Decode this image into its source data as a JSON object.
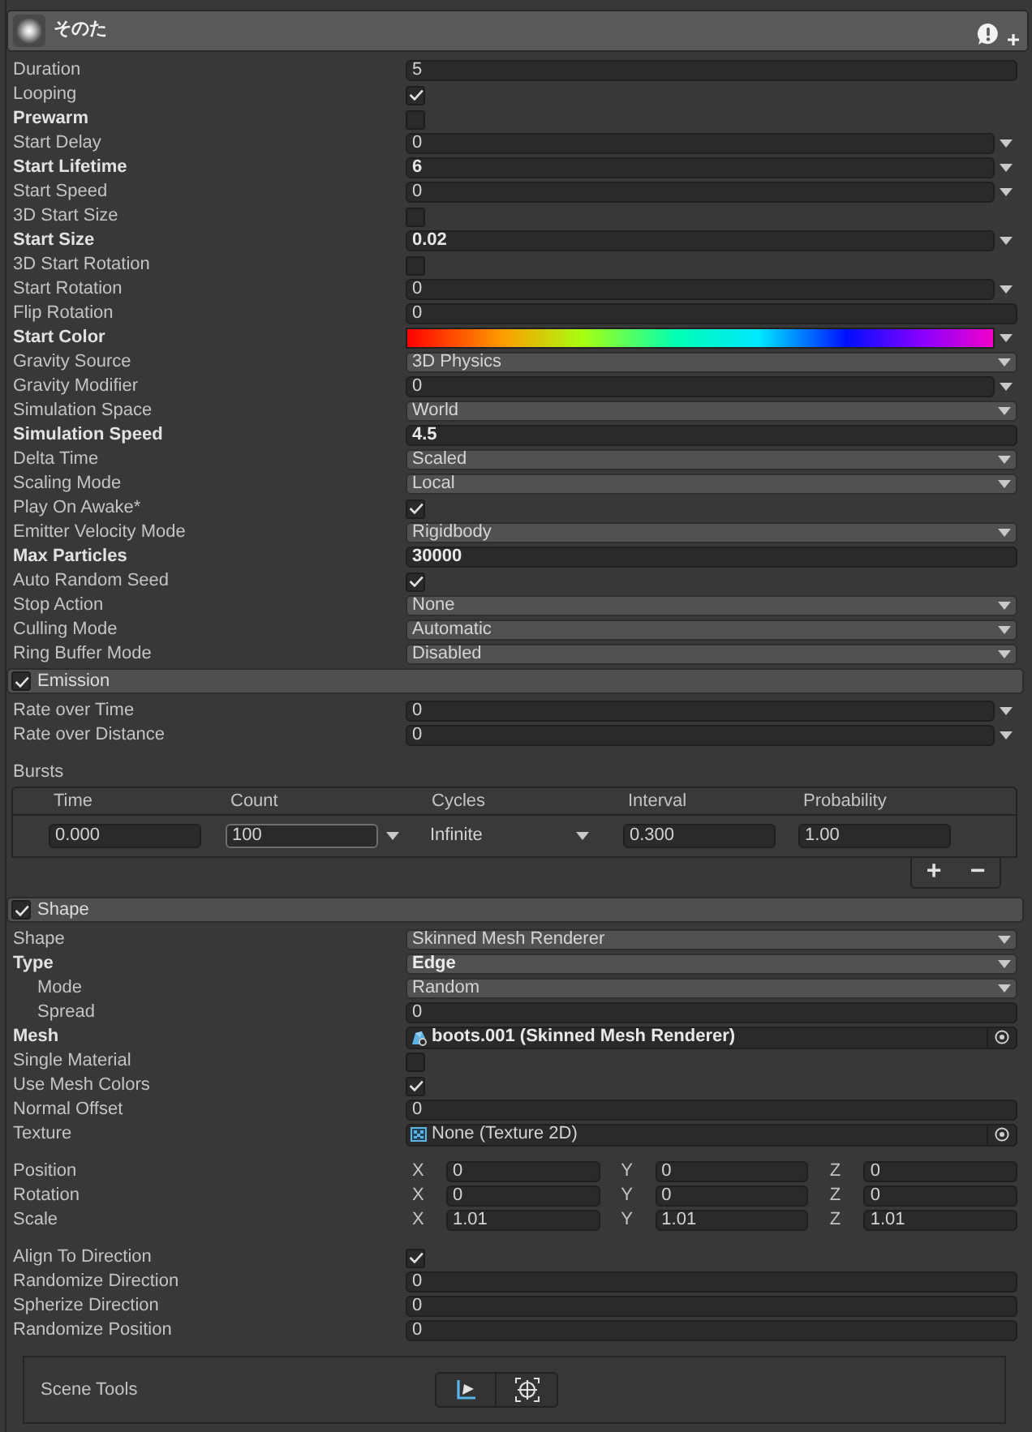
{
  "component": {
    "title": "そのた"
  },
  "main": {
    "properties": [
      {
        "label": "Duration",
        "kind": "field",
        "value": "5",
        "bold": false
      },
      {
        "label": "Looping",
        "kind": "checkbox",
        "checked": true,
        "bold": false
      },
      {
        "label": "Prewarm",
        "kind": "checkbox",
        "checked": false,
        "bold": true
      },
      {
        "label": "Start Delay",
        "kind": "curve",
        "value": "0",
        "bold": false
      },
      {
        "label": "Start Lifetime",
        "kind": "curve",
        "value": "6",
        "bold": true
      },
      {
        "label": "Start Speed",
        "kind": "curve",
        "value": "0",
        "bold": false
      },
      {
        "label": "3D Start Size",
        "kind": "checkbox",
        "checked": false,
        "bold": false
      },
      {
        "label": "Start Size",
        "kind": "curve",
        "value": "0.02",
        "bold": true
      },
      {
        "label": "3D Start Rotation",
        "kind": "checkbox",
        "checked": false,
        "bold": false
      },
      {
        "label": "Start Rotation",
        "kind": "curve",
        "value": "0",
        "bold": false
      },
      {
        "label": "Flip Rotation",
        "kind": "field",
        "value": "0",
        "bold": false
      },
      {
        "label": "Start Color",
        "kind": "gradient",
        "bold": true
      },
      {
        "label": "Gravity Source",
        "kind": "dropdown",
        "value": "3D Physics",
        "bold": false
      },
      {
        "label": "Gravity Modifier",
        "kind": "curve",
        "value": "0",
        "bold": false
      },
      {
        "label": "Simulation Space",
        "kind": "dropdown",
        "value": "World",
        "bold": false
      },
      {
        "label": "Simulation Speed",
        "kind": "field",
        "value": "4.5",
        "bold": true
      },
      {
        "label": "Delta Time",
        "kind": "dropdown",
        "value": "Scaled",
        "bold": false
      },
      {
        "label": "Scaling Mode",
        "kind": "dropdown",
        "value": "Local",
        "bold": false
      },
      {
        "label": "Play On Awake*",
        "kind": "checkbox",
        "checked": true,
        "bold": false
      },
      {
        "label": "Emitter Velocity Mode",
        "kind": "dropdown",
        "value": "Rigidbody",
        "bold": false
      },
      {
        "label": "Max Particles",
        "kind": "field",
        "value": "30000",
        "bold": true
      },
      {
        "label": "Auto Random Seed",
        "kind": "checkbox",
        "checked": true,
        "bold": false
      },
      {
        "label": "Stop Action",
        "kind": "dropdown",
        "value": "None",
        "bold": false
      },
      {
        "label": "Culling Mode",
        "kind": "dropdown",
        "value": "Automatic",
        "bold": false
      },
      {
        "label": "Ring Buffer Mode",
        "kind": "dropdown",
        "value": "Disabled",
        "bold": false
      }
    ]
  },
  "modules": [
    {
      "title": "Emission",
      "enabled": true,
      "property_groups": [
        {
          "properties": [
            {
              "label": "Rate over Time",
              "kind": "curve",
              "value": "0",
              "bold": false
            },
            {
              "label": "Rate over Distance",
              "kind": "curve",
              "value": "0",
              "bold": false
            }
          ]
        }
      ],
      "bursts": {
        "label": "Bursts",
        "columns": [
          "Time",
          "Count",
          "Cycles",
          "Interval",
          "Probability"
        ],
        "rows": [
          {
            "cells": [
              {
                "kind": "field",
                "value": "0.000",
                "highlighted": false
              },
              {
                "kind": "curve",
                "value": "100",
                "highlighted": true
              },
              {
                "kind": "choice",
                "value": "Infinite",
                "highlighted": false
              },
              {
                "kind": "field",
                "value": "0.300",
                "highlighted": false
              },
              {
                "kind": "field",
                "value": "1.00",
                "highlighted": false
              }
            ]
          }
        ],
        "buttons": [
          "+",
          "−"
        ]
      }
    },
    {
      "title": "Shape",
      "enabled": true,
      "property_groups": [
        {
          "properties": [
            {
              "label": "Shape",
              "kind": "dropdown",
              "value": "Skinned Mesh Renderer",
              "bold": false
            },
            {
              "label": "Type",
              "kind": "dropdown",
              "value": "Edge",
              "bold": true,
              "children": [
                {
                  "label": "Mode",
                  "kind": "dropdown",
                  "value": "Random",
                  "bold": false
                },
                {
                  "label": "Spread",
                  "kind": "field",
                  "value": "0",
                  "bold": false
                }
              ]
            },
            {
              "label": "Mesh",
              "kind": "mesh",
              "value": "boots.001 (Skinned Mesh Renderer)",
              "bold": true
            },
            {
              "label": "Single Material",
              "kind": "checkbox",
              "checked": false,
              "bold": false
            },
            {
              "label": "Use Mesh Colors",
              "kind": "checkbox",
              "checked": true,
              "bold": false
            },
            {
              "label": "Normal Offset",
              "kind": "field",
              "value": "0",
              "bold": false
            },
            {
              "label": "Texture",
              "kind": "texture",
              "value": "None (Texture 2D)",
              "bold": false
            }
          ]
        },
        {
          "properties": [
            {
              "label": "Position",
              "kind": "vector3",
              "bold": false,
              "components": [
                {
                  "axis": "X",
                  "value": "0"
                },
                {
                  "axis": "Y",
                  "value": "0"
                },
                {
                  "axis": "Z",
                  "value": "0"
                }
              ]
            },
            {
              "label": "Rotation",
              "kind": "vector3",
              "bold": false,
              "components": [
                {
                  "axis": "X",
                  "value": "0"
                },
                {
                  "axis": "Y",
                  "value": "0"
                },
                {
                  "axis": "Z",
                  "value": "0"
                }
              ]
            },
            {
              "label": "Scale",
              "kind": "vector3",
              "bold": false,
              "components": [
                {
                  "axis": "X",
                  "value": "1.01"
                },
                {
                  "axis": "Y",
                  "value": "1.01"
                },
                {
                  "axis": "Z",
                  "value": "1.01"
                }
              ]
            }
          ]
        },
        {
          "properties": [
            {
              "label": "Align To Direction",
              "kind": "checkbox",
              "checked": true,
              "bold": false
            },
            {
              "label": "Randomize Direction",
              "kind": "field",
              "value": "0",
              "bold": false
            },
            {
              "label": "Spherize Direction",
              "kind": "field",
              "value": "0",
              "bold": false
            },
            {
              "label": "Randomize Position",
              "kind": "field",
              "value": "0",
              "bold": false
            }
          ]
        }
      ],
      "scene_tools": {
        "label": "Scene Tools"
      }
    }
  ]
}
